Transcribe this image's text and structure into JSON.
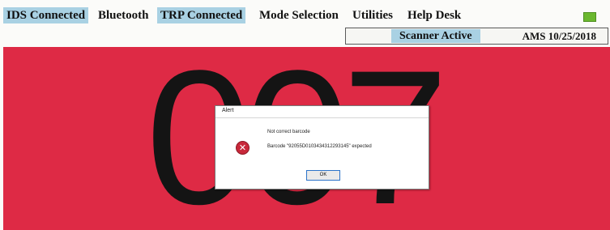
{
  "menu": {
    "items": [
      {
        "label": "IDS Connected",
        "highlight": true
      },
      {
        "label": "Bluetooth",
        "highlight": false
      },
      {
        "label": "TRP Connected",
        "highlight": true
      },
      {
        "label": "Mode Selection",
        "highlight": false
      },
      {
        "label": "Utilities",
        "highlight": false
      },
      {
        "label": "Help Desk",
        "highlight": false
      }
    ],
    "indicator_color": "#6bb82f"
  },
  "status": {
    "scanner": "Scanner Active",
    "version": "AMS 10/25/2018"
  },
  "main": {
    "code": "007",
    "background_color": "#de2a45"
  },
  "dialog": {
    "title": "Alert",
    "icon": "error-icon",
    "line1": "Not correct barcode",
    "line2": "Barcode \"92055D0103434312293145\" expected",
    "ok_label": "OK"
  }
}
